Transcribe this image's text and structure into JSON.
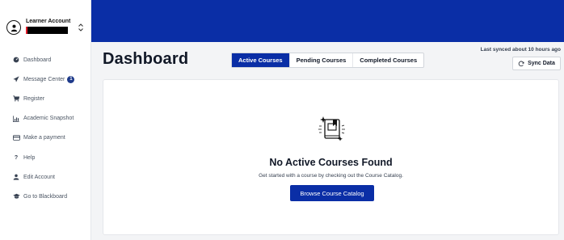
{
  "account": {
    "label": "Learner Account"
  },
  "sidebar": {
    "items": [
      {
        "label": "Dashboard",
        "icon": "gauge-icon"
      },
      {
        "label": "Message Center",
        "icon": "send-icon",
        "badge": "1"
      },
      {
        "label": "Register",
        "icon": "cart-icon"
      },
      {
        "label": "Academic Snapshot",
        "icon": "bar-chart-icon"
      },
      {
        "label": "Make a payment",
        "icon": "credit-card-icon"
      },
      {
        "label": "Help",
        "icon": "question-icon"
      },
      {
        "label": "Edit Account",
        "icon": "user-icon"
      },
      {
        "label": "Go to Blackboard",
        "icon": "graduation-cap-icon"
      }
    ]
  },
  "header": {
    "title": "Dashboard",
    "tabs": [
      {
        "label": "Active Courses",
        "active": true
      },
      {
        "label": "Pending Courses",
        "active": false
      },
      {
        "label": "Completed Courses",
        "active": false
      }
    ],
    "sync_status": "Last synced about 10 hours ago",
    "sync_button": "Sync Data"
  },
  "empty_state": {
    "title": "No Active Courses Found",
    "subtitle": "Get started with a course by checking out the Course Catalog.",
    "button": "Browse Course Catalog",
    "icon": "book-sparkle-icon"
  },
  "colors": {
    "brand": "#0a2ea6",
    "badge": "#1e3a8a",
    "background": "#f3f4f6"
  }
}
